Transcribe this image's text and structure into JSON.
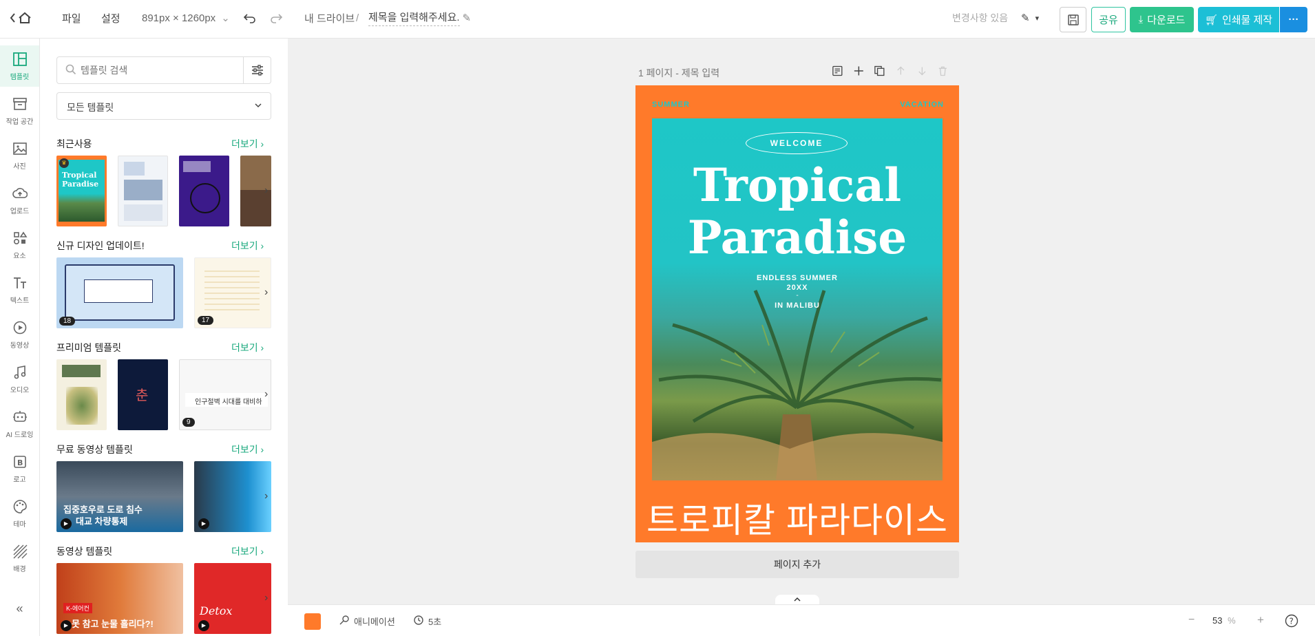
{
  "topbar": {
    "file": "파일",
    "settings": "설정",
    "size": "891px × 1260px",
    "breadcrumb_root": "내 드라이브",
    "breadcrumb_sep": "/",
    "doc_title": "제목을 입력해주세요.",
    "change_status": "변경사항 있음",
    "share": "공유",
    "download": "다운로드",
    "print": "인쇄물 제작",
    "colors": {
      "accent": "#2ec4a0",
      "print": "#1cbfd6"
    }
  },
  "nav": {
    "items": [
      {
        "label": "템플릿",
        "icon": "template-icon"
      },
      {
        "label": "작업 공간",
        "icon": "workspace-icon"
      },
      {
        "label": "사진",
        "icon": "photo-icon"
      },
      {
        "label": "업로드",
        "icon": "upload-icon"
      },
      {
        "label": "요소",
        "icon": "elements-icon"
      },
      {
        "label": "텍스트",
        "icon": "text-icon"
      },
      {
        "label": "동영상",
        "icon": "video-icon"
      },
      {
        "label": "오디오",
        "icon": "audio-icon"
      },
      {
        "label": "AI 드로잉",
        "icon": "ai-drawing-icon"
      },
      {
        "label": "로고",
        "icon": "logo-icon"
      },
      {
        "label": "테마",
        "icon": "theme-icon"
      },
      {
        "label": "배경",
        "icon": "background-icon"
      }
    ],
    "collapse": "«"
  },
  "panel": {
    "search_placeholder": "템플릿 검색",
    "dropdown": "모든 템플릿",
    "more": "더보기",
    "sections": [
      {
        "title": "최근사용"
      },
      {
        "title": "신규 디자인 업데이트!",
        "counts": [
          "18",
          "17"
        ]
      },
      {
        "title": "프리미엄 템플릿",
        "counts": [
          "9"
        ]
      },
      {
        "title": "무료 동영상 템플릿"
      },
      {
        "title": "동영상 템플릿"
      }
    ],
    "thumb_texts": {
      "tropical1": "Tropical",
      "tropical2": "Paradise",
      "blue_card": "인구절벽 시대를 대비하",
      "video1": "집중호우로 도로 침수",
      "video1b": "대교 차량통제",
      "video2": "K-에어컨",
      "video2b": "못 참고 눈물 흘리다?!",
      "detox": "Detox",
      "chun": "춘"
    }
  },
  "canvas": {
    "page_label": "1 페이지 - 제목 입력",
    "add_page": "페이지 추가",
    "poster": {
      "top_left": "SUMMER",
      "top_right": "VACATION",
      "welcome": "WELCOME",
      "title1": "Tropical",
      "title2": "Paradise",
      "sub1": "ENDLESS SUMMER",
      "sub2": "20XX",
      "sub3": "-",
      "sub4": "IN MALIBU",
      "korean": "트로피칼 파라다이스",
      "colors": {
        "orange": "#ff7a2a",
        "teal": "#1ec7c7"
      }
    }
  },
  "bottombar": {
    "animation": "애니메이션",
    "duration": "5초",
    "zoom": "53",
    "zoom_unit": "%",
    "swatch": "#ff7a2a"
  }
}
